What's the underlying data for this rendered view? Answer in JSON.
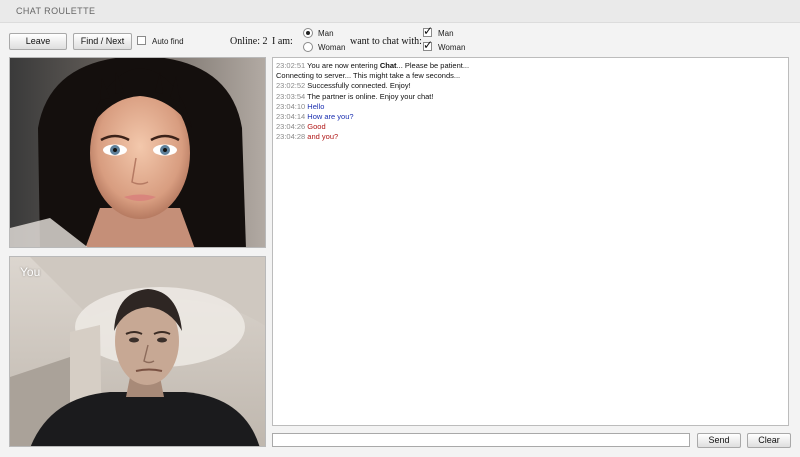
{
  "header": {
    "title": "CHAT ROULETTE"
  },
  "toolbar": {
    "leave_label": "Leave",
    "next_label": "Find / Next",
    "auto_find_label": "Auto find",
    "auto_find_checked": false,
    "online_label": "Online: 2"
  },
  "prefs": {
    "i_am_label": "I am:",
    "i_am_options": [
      "Man",
      "Woman"
    ],
    "i_am_selected": "Man",
    "want_label": "want to chat with:",
    "want_options": [
      "Man",
      "Woman"
    ],
    "want_checked": [
      true,
      true
    ]
  },
  "video": {
    "self_label": "You"
  },
  "chat": {
    "lines": [
      {
        "time": "23:02:51",
        "pre": "You are now entering ",
        "bold": "Chat",
        "post": "... Please be patient...",
        "color": "system"
      },
      {
        "time": "",
        "pre": "Connecting to server... This might take a few seconds...",
        "bold": "",
        "post": "",
        "color": "system"
      },
      {
        "time": "23:02:52",
        "pre": "Successfully connected. Enjoy!",
        "bold": "",
        "post": "",
        "color": "system"
      },
      {
        "time": "23:03:54",
        "pre": "The partner is online. Enjoy your chat!",
        "bold": "",
        "post": "",
        "color": "system"
      },
      {
        "time": "23:04:10",
        "pre": "Hello",
        "bold": "",
        "post": "",
        "color": "blue"
      },
      {
        "time": "23:04:14",
        "pre": "How are you?",
        "bold": "",
        "post": "",
        "color": "blue"
      },
      {
        "time": "23:04:26",
        "pre": "Good",
        "bold": "",
        "post": "",
        "color": "red"
      },
      {
        "time": "23:04:28",
        "pre": "and you?",
        "bold": "",
        "post": "",
        "color": "red"
      }
    ],
    "input_value": "",
    "send_label": "Send",
    "clear_label": "Clear"
  },
  "colors": {
    "blue": "#1a2fb0",
    "red": "#b01616",
    "timestamp": "#8a8a8a"
  }
}
